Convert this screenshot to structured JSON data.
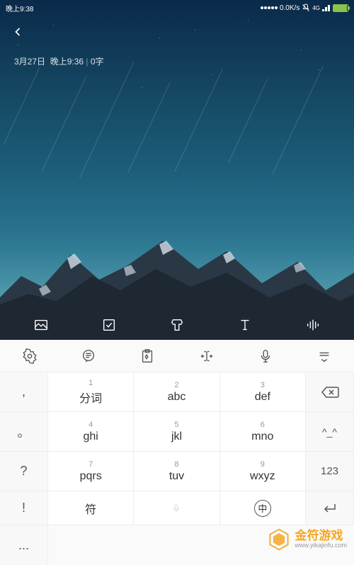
{
  "status": {
    "time": "晚上9:38",
    "net_speed": "0.0K/s",
    "net_label": "4G",
    "battery_text": "98"
  },
  "note": {
    "date": "3月27日",
    "time": "晚上9:36",
    "word_count": "0字"
  },
  "keyboard": {
    "side_left": [
      ",",
      "。",
      "?",
      "!",
      "..."
    ],
    "side_right": {
      "face": "^_^",
      "num": "123"
    },
    "keys": [
      {
        "n": "1",
        "m": "分词"
      },
      {
        "n": "2",
        "m": "abc"
      },
      {
        "n": "3",
        "m": "def"
      },
      {
        "n": "4",
        "m": "ghi"
      },
      {
        "n": "5",
        "m": "jkl"
      },
      {
        "n": "6",
        "m": "mno"
      },
      {
        "n": "7",
        "m": "pqrs"
      },
      {
        "n": "8",
        "m": "tuv"
      },
      {
        "n": "9",
        "m": "wxyz"
      }
    ],
    "bottom": {
      "symbol": "符",
      "chinese": "中"
    }
  },
  "watermark": {
    "title": "金符游戏",
    "sub": "www.yikajinfu.com"
  }
}
